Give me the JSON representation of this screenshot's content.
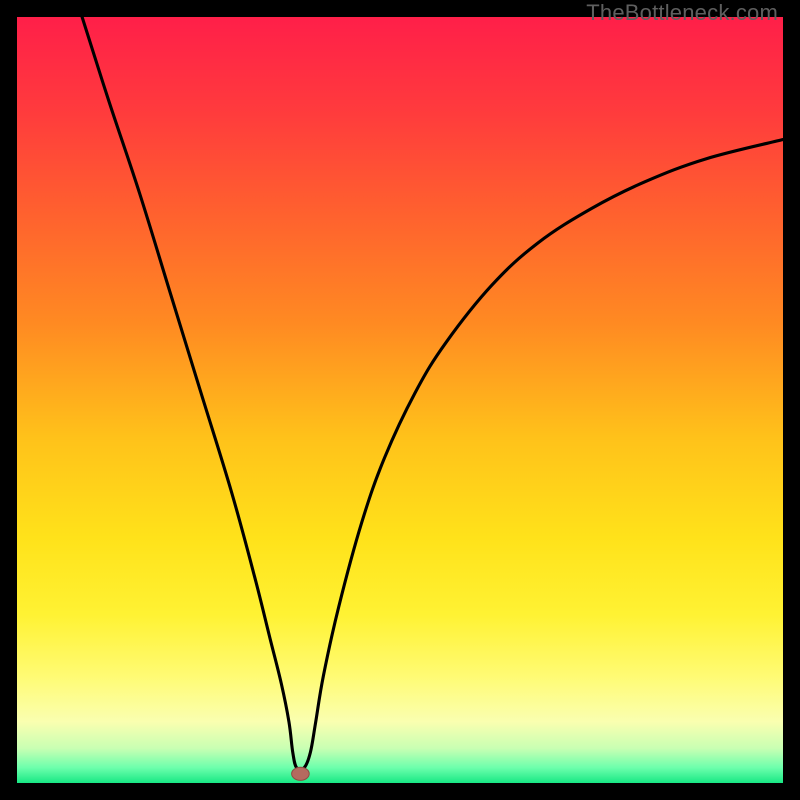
{
  "watermark": "TheBottleneck.com",
  "colors": {
    "frame": "#000000",
    "curve": "#000000",
    "marker_fill": "#b56a5f",
    "marker_stroke": "#8e4d44"
  },
  "chart_data": {
    "type": "line",
    "title": "",
    "xlabel": "",
    "ylabel": "",
    "xlim": [
      0,
      100
    ],
    "ylim": [
      0,
      100
    ],
    "grid": false,
    "legend": false,
    "background_gradient": {
      "stops": [
        {
          "pos": 0.0,
          "color": "#ff1f49"
        },
        {
          "pos": 0.12,
          "color": "#ff3a3d"
        },
        {
          "pos": 0.25,
          "color": "#ff5f2f"
        },
        {
          "pos": 0.4,
          "color": "#ff8a22"
        },
        {
          "pos": 0.55,
          "color": "#ffc21a"
        },
        {
          "pos": 0.68,
          "color": "#ffe21a"
        },
        {
          "pos": 0.78,
          "color": "#fff233"
        },
        {
          "pos": 0.86,
          "color": "#fffb73"
        },
        {
          "pos": 0.92,
          "color": "#faffb0"
        },
        {
          "pos": 0.955,
          "color": "#c8ffb3"
        },
        {
          "pos": 0.98,
          "color": "#6dffac"
        },
        {
          "pos": 1.0,
          "color": "#18e884"
        }
      ]
    },
    "series": [
      {
        "name": "bottleneck-curve",
        "x": [
          8.5,
          12,
          16,
          20,
          24,
          28,
          31,
          33,
          34.5,
          35.5,
          36,
          36.5,
          37.5,
          38.3,
          39,
          40,
          42,
          45,
          48,
          52,
          56,
          62,
          68,
          75,
          82,
          90,
          100
        ],
        "y": [
          100,
          89,
          77,
          64,
          51,
          38,
          27,
          19,
          13,
          8,
          4,
          2,
          2,
          4,
          8,
          14,
          23,
          34,
          42.5,
          51,
          57.5,
          65,
          70.5,
          75,
          78.5,
          81.5,
          84
        ]
      }
    ],
    "marker": {
      "x": 37,
      "y": 1.2,
      "rx": 1.15,
      "ry": 0.85
    }
  }
}
